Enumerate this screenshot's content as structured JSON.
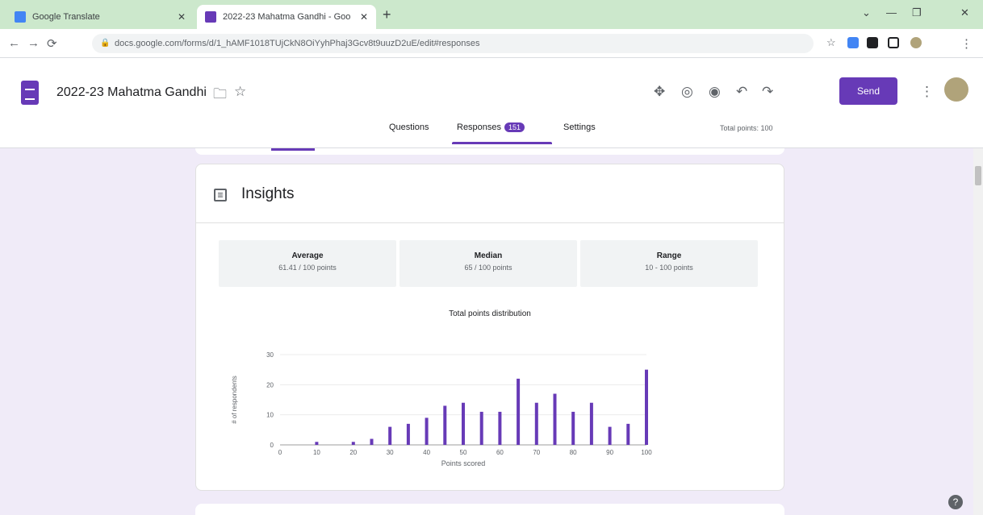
{
  "browser": {
    "tabs": [
      {
        "title": "Google Translate",
        "icon": "translate-icon"
      },
      {
        "title": "2022-23 Mahatma Gandhi - Goo",
        "icon": "forms-icon"
      }
    ],
    "new_tab": "+",
    "url": "docs.google.com/forms/d/1_hAMF1018TUjCkN8OiYyhPhaj3Gcv8t9uuzD2uE/edit#responses",
    "window_controls": [
      "⌄",
      "—",
      "❐",
      "✕"
    ]
  },
  "header": {
    "doc_title": "2022-23 Mahatma Gandhi",
    "send_label": "Send",
    "tabs": {
      "questions": "Questions",
      "responses": "Responses",
      "responses_count": "151",
      "settings": "Settings"
    },
    "total_points": "Total points: 100"
  },
  "insights": {
    "title": "Insights",
    "stats": [
      {
        "name": "Average",
        "value": "61.41 / 100 points"
      },
      {
        "name": "Median",
        "value": "65 / 100 points"
      },
      {
        "name": "Range",
        "value": "10 - 100 points"
      }
    ]
  },
  "colors": {
    "accent": "#673ab7",
    "background": "#f0ebf8",
    "tab_strip": "#cce8cc"
  },
  "chart_data": {
    "type": "bar",
    "title": "Total points distribution",
    "xlabel": "Points scored",
    "ylabel": "# of respondents",
    "x": [
      10,
      20,
      25,
      30,
      35,
      40,
      45,
      50,
      55,
      60,
      65,
      70,
      75,
      80,
      85,
      90,
      95,
      100
    ],
    "values": [
      1,
      1,
      2,
      6,
      7,
      9,
      13,
      14,
      11,
      11,
      22,
      14,
      17,
      11,
      14,
      6,
      7,
      25
    ],
    "xticks": [
      "0",
      "10",
      "20",
      "30",
      "40",
      "50",
      "60",
      "70",
      "80",
      "90",
      "100"
    ],
    "yticks": [
      "0",
      "10",
      "20",
      "30"
    ],
    "xlim": [
      0,
      100
    ],
    "ylim": [
      0,
      30
    ],
    "bar_color": "#673ab7"
  }
}
